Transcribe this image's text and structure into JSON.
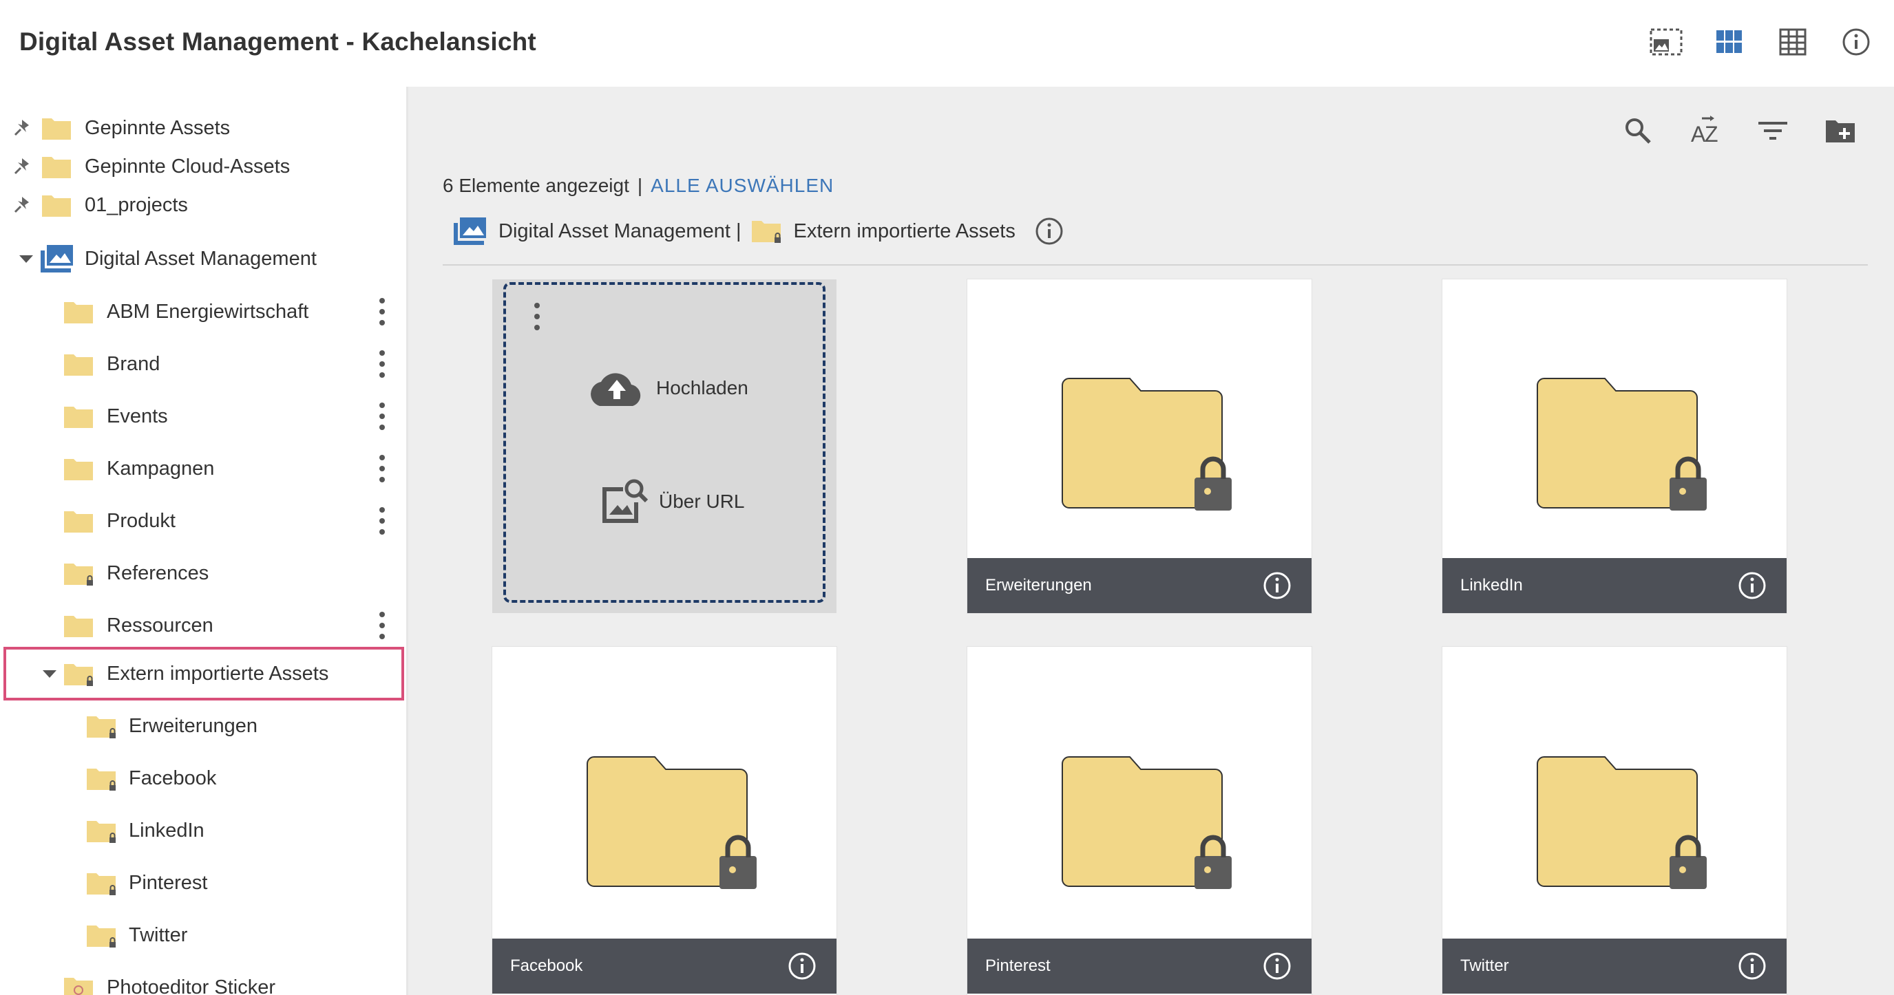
{
  "header": {
    "title": "Digital Asset Management - Kachelansicht",
    "icons": [
      "image-select-icon",
      "grid-view-icon",
      "table-view-icon",
      "info-icon"
    ]
  },
  "sidebar": {
    "pinned": [
      {
        "label": "Gepinnte Assets"
      },
      {
        "label": "Gepinnte Cloud-Assets"
      },
      {
        "label": "01_projects"
      }
    ],
    "root": {
      "label": "Digital Asset Management"
    },
    "folders": [
      {
        "label": "ABM Energiewirtschaft"
      },
      {
        "label": "Brand"
      },
      {
        "label": "Events"
      },
      {
        "label": "Kampagnen"
      },
      {
        "label": "Produkt"
      },
      {
        "label": "References"
      },
      {
        "label": "Ressourcen"
      },
      {
        "label": "Extern importierte Assets"
      }
    ],
    "subfolders": [
      {
        "label": "Erweiterungen"
      },
      {
        "label": "Facebook"
      },
      {
        "label": "LinkedIn"
      },
      {
        "label": "Pinterest"
      },
      {
        "label": "Twitter"
      }
    ],
    "extra": {
      "label": "Photoeditor Sticker"
    }
  },
  "main": {
    "count_text": "6 Elemente angezeigt",
    "separator": "|",
    "select_all": "ALLE AUSWÄHLEN",
    "breadcrumb": {
      "root": "Digital Asset Management |",
      "current": "Extern importierte Assets"
    },
    "upload": {
      "upload_label": "Hochladen",
      "url_label": "Über URL"
    },
    "tiles": [
      {
        "name": "Erweiterungen"
      },
      {
        "name": "LinkedIn"
      },
      {
        "name": "Facebook"
      },
      {
        "name": "Pinterest"
      },
      {
        "name": "Twitter"
      }
    ]
  },
  "colors": {
    "folder_fill": "#f2d788",
    "accent_blue": "#3c76b8",
    "selection_border": "#d9507a",
    "tile_footer": "#4d5057"
  }
}
